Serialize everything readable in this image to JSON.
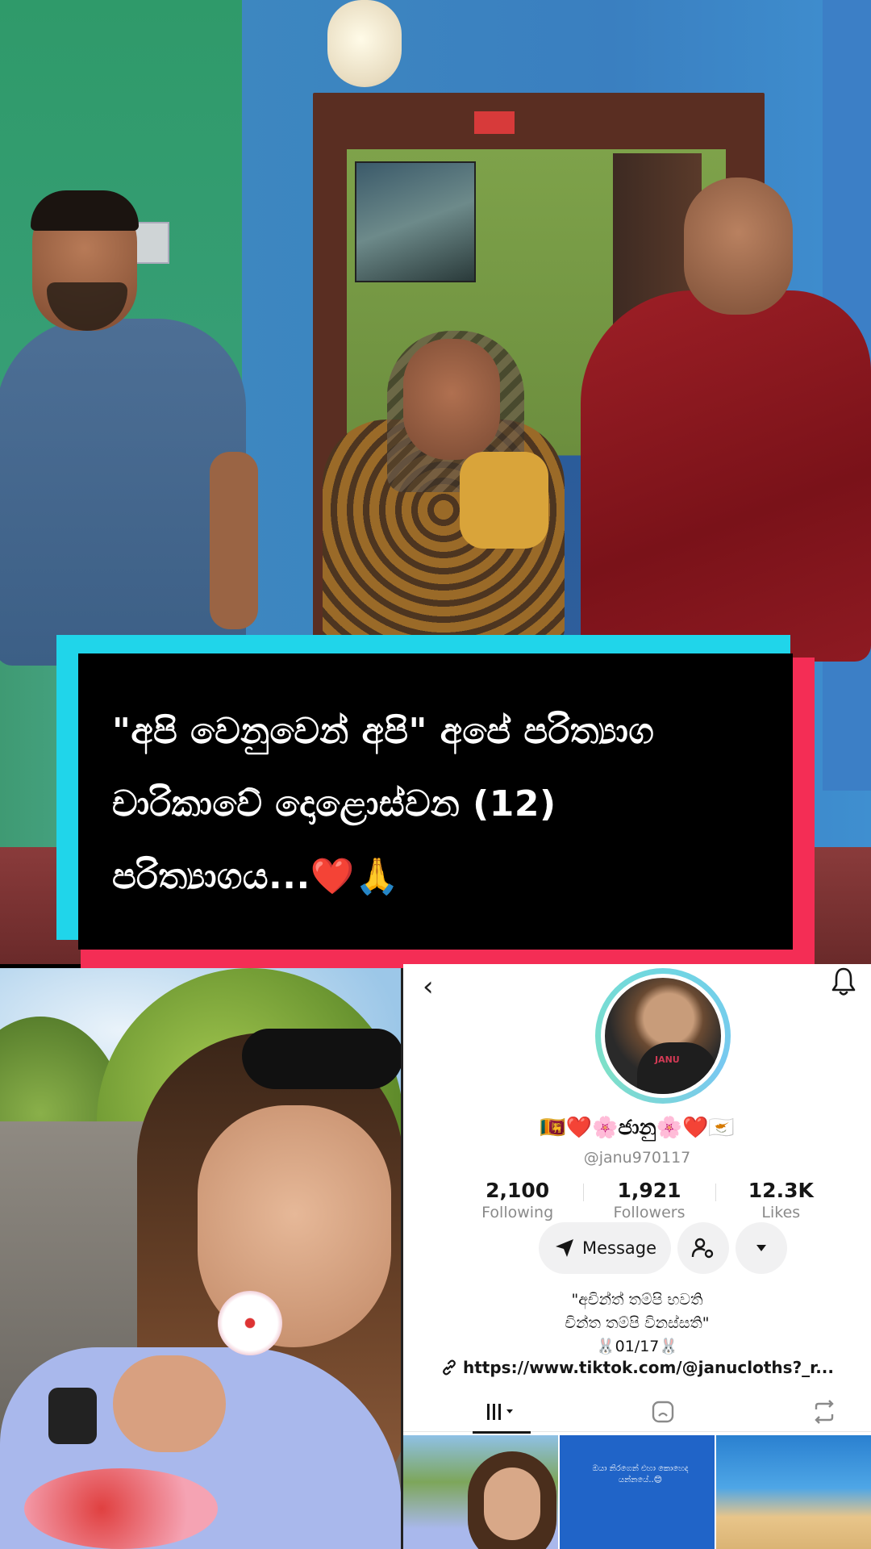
{
  "caption": {
    "line1": "\"අපි වෙනුවෙන් අපි\" අපේ පරිත්‍යාග",
    "line2": "චාරිකාවේ දොළොස්වන (12)",
    "line3": "පරිත්‍යාගය...❤️🙏"
  },
  "profile": {
    "display_name": "🇱🇰❤️🌸ජානු🌸❤️🇨🇾",
    "username": "@janu970117",
    "stats": [
      {
        "value": "2,100",
        "label": "Following"
      },
      {
        "value": "1,921",
        "label": "Followers"
      },
      {
        "value": "12.3K",
        "label": "Likes"
      }
    ],
    "message_label": "Message",
    "bio": [
      "\"අචින්ත් තම්පි භවති",
      "චින්ත තම්පි විනස්සති\"",
      "🐰01/17🐰"
    ],
    "link": "https://www.tiktok.com/@janucloths?_r..."
  },
  "thumb_text": "ඔයා නිරගෙන් එහා කොහෙද යන්නයේ..😊",
  "icons": [
    "back-chevron-icon",
    "bell-icon",
    "send-icon",
    "user-settings-icon",
    "caret-down-icon",
    "grid-icon",
    "repost-icon",
    "liked-icon",
    "link-icon"
  ],
  "colors": {
    "caption_cyan": "#20d5ea",
    "caption_red": "#f42d55",
    "avatar_ring": "#6fd6e2"
  }
}
